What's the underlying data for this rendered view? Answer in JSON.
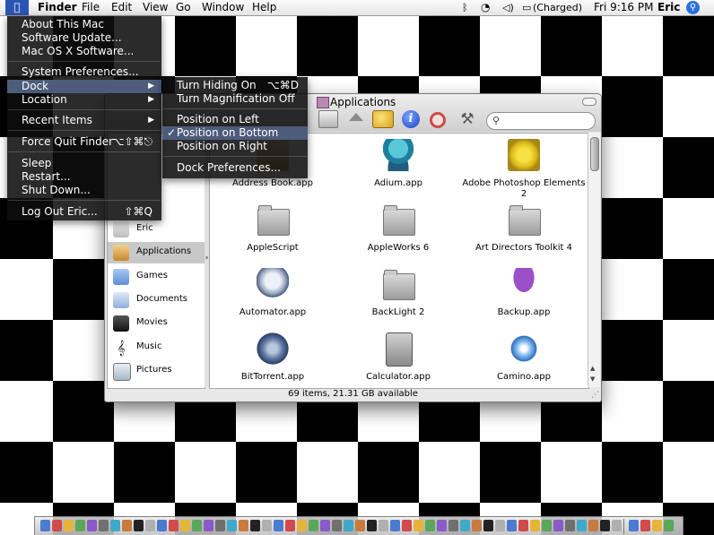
{
  "menubar": {
    "apple_icon": "apple-logo-icon",
    "items": [
      "Finder",
      "File",
      "Edit",
      "View",
      "Go",
      "Window",
      "Help"
    ],
    "status": {
      "bluetooth_icon": "bluetooth-icon",
      "wifi_icon": "wifi-icon",
      "volume_icon": "volume-icon",
      "battery_text": "(Charged)",
      "clock": "Fri 9:16 PM",
      "user": "Eric",
      "spotlight_icon": "spotlight-icon"
    }
  },
  "apple_menu": {
    "items": [
      {
        "label": "About This Mac"
      },
      {
        "label": "Software Update..."
      },
      {
        "label": "Mac OS X Software..."
      },
      {
        "label": "System Preferences..."
      },
      {
        "label": "Dock",
        "submenu": true,
        "selected": true
      },
      {
        "label": "Location",
        "submenu": true
      },
      {
        "label": "Recent Items",
        "submenu": true
      },
      {
        "label": "Force Quit Finder",
        "shortcut": "⌥⇧⌘⎋"
      },
      {
        "label": "Sleep"
      },
      {
        "label": "Restart..."
      },
      {
        "label": "Shut Down..."
      },
      {
        "label": "Log Out Eric...",
        "shortcut": "⇧⌘Q"
      }
    ]
  },
  "dock_submenu": {
    "items": [
      {
        "label": "Turn Hiding On",
        "shortcut": "⌥⌘D"
      },
      {
        "label": "Turn Magnification Off"
      },
      {
        "label": "Position on Left"
      },
      {
        "label": "Position on Bottom",
        "checked": true,
        "selected": true
      },
      {
        "label": "Position on Right"
      },
      {
        "label": "Dock Preferences..."
      }
    ]
  },
  "finder_window": {
    "title": "Applications",
    "search_placeholder": "",
    "sidebar": [
      {
        "label": "Eric",
        "icon": "home-icon"
      },
      {
        "label": "Applications",
        "icon": "applications-icon",
        "selected": true
      },
      {
        "label": "Games",
        "icon": "folder-icon"
      },
      {
        "label": "Documents",
        "icon": "documents-icon"
      },
      {
        "label": "Movies",
        "icon": "movies-icon"
      },
      {
        "label": "Music",
        "icon": "music-icon"
      },
      {
        "label": "Pictures",
        "icon": "pictures-icon"
      }
    ],
    "files": [
      {
        "name": "Address Book.app",
        "icon": "address-book-icon"
      },
      {
        "name": "Adium.app",
        "icon": "adium-icon"
      },
      {
        "name": "Adobe Photoshop Elements 2",
        "icon": "folder-icon"
      },
      {
        "name": "AppleScript",
        "icon": "folder-icon"
      },
      {
        "name": "AppleWorks 6",
        "icon": "folder-icon"
      },
      {
        "name": "Art Directors Toolkit 4",
        "icon": "folder-icon"
      },
      {
        "name": "Automator.app",
        "icon": "automator-icon"
      },
      {
        "name": "BackLight 2",
        "icon": "folder-icon"
      },
      {
        "name": "Backup.app",
        "icon": "backup-umbrella-icon"
      },
      {
        "name": "BitTorrent.app",
        "icon": "bittorrent-icon"
      },
      {
        "name": "Calculator.app",
        "icon": "calculator-icon"
      },
      {
        "name": "Camino.app",
        "icon": "camino-icon"
      }
    ],
    "status": "69 items, 21.31 GB available"
  },
  "colors": {
    "menu_bg": "#0e0e0e",
    "menu_selected": "#4d5c7b",
    "checker_dark": "#000000",
    "checker_light": "#ffffff",
    "sidebar_selected": "#c8c8c8"
  }
}
